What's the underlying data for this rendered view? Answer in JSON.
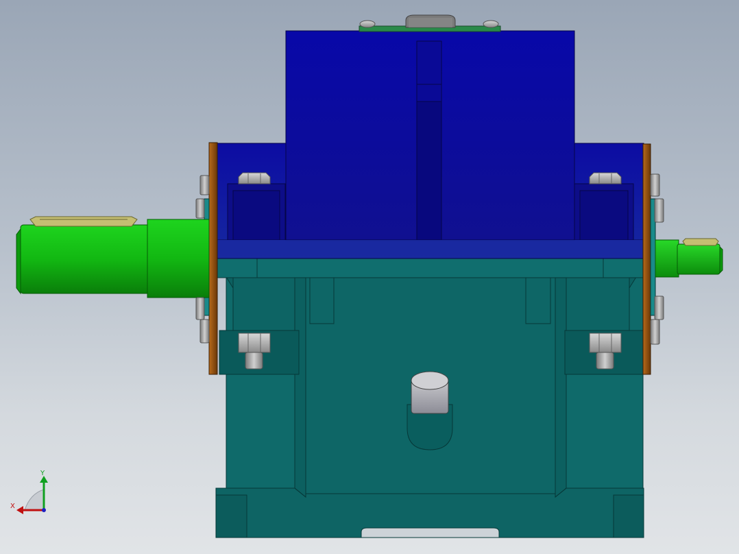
{
  "viewport": {
    "background_top": "#9aa6b6",
    "background_bottom": "#e1e4e7"
  },
  "model": {
    "parts": [
      "housing-top-cover",
      "housing-base",
      "input-shaft",
      "output-shaft",
      "flange-left",
      "flange-right",
      "vent-plug",
      "drain-plug",
      "hex-bolt"
    ],
    "colors": {
      "cover": "#0a0aa0",
      "base": "#0f6868",
      "shaft": "#10c010",
      "flange": "#8a4a10",
      "bolt": "#a8a8a8",
      "key": "#b8b46a"
    }
  },
  "triad": {
    "x_label": "X",
    "y_label": "Y",
    "x_color": "#c01010",
    "y_color": "#10a020"
  }
}
